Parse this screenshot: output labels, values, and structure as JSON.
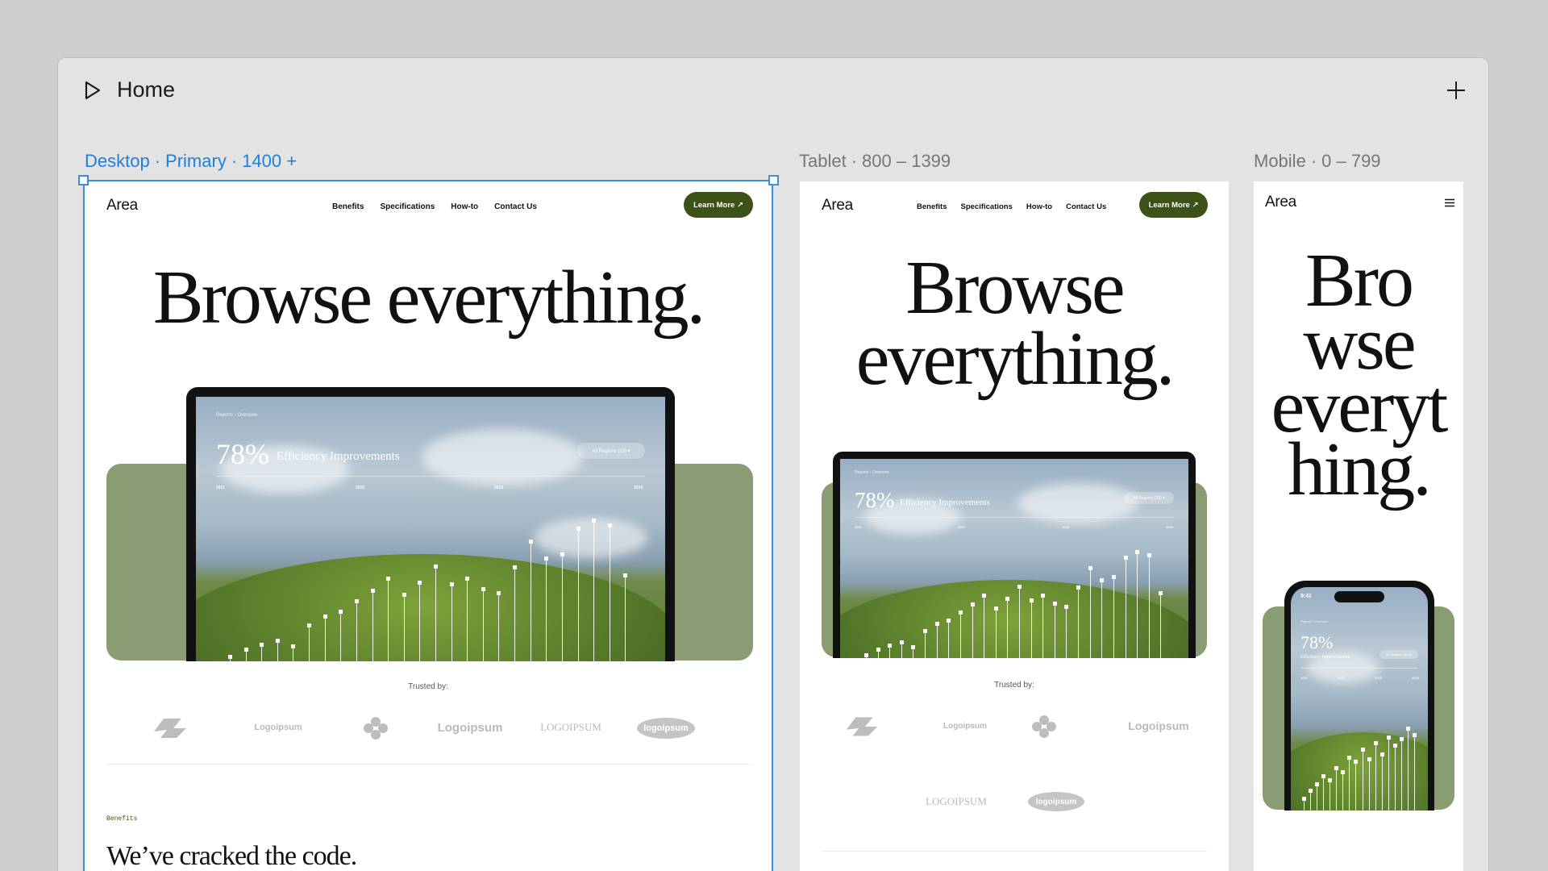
{
  "toolbar": {
    "title": "Home"
  },
  "breakpoints": {
    "desktop": {
      "name": "Desktop",
      "kind": "Primary",
      "range": "1400 +"
    },
    "tablet": {
      "name": "Tablet",
      "range": "800 – 1399"
    },
    "mobile": {
      "name": "Mobile",
      "range": "0 – 799"
    }
  },
  "site": {
    "brand": "Area",
    "nav": [
      "Benefits",
      "Specifications",
      "How-to",
      "Contact Us"
    ],
    "cta": "Learn More ↗",
    "hero": "Browse everything.",
    "hero_tablet_lines": [
      "Browse",
      "everything."
    ],
    "hero_mobile_lines": [
      "Bro",
      "wse",
      "everyt",
      "hing."
    ],
    "dashboard": {
      "breadcrumb": "Reports  ›  Overview",
      "stat": "78%",
      "stat_label": "Efficiency Improvements",
      "filter": "All Regions (33)  ▾",
      "years": [
        "2021",
        "2022",
        "2023",
        "2024"
      ]
    },
    "phone_time": "9:41",
    "trusted": "Trusted by:",
    "logos": [
      "Logoipsum",
      "Logoipsum",
      "LOGOIPSUM",
      "logoipsum"
    ],
    "section_kicker": "Benefits",
    "section_heading": "We’ve cracked the code."
  },
  "colors": {
    "accent": "#3d5218",
    "selection": "#3b8fe0",
    "sage": "#8a9c72"
  }
}
